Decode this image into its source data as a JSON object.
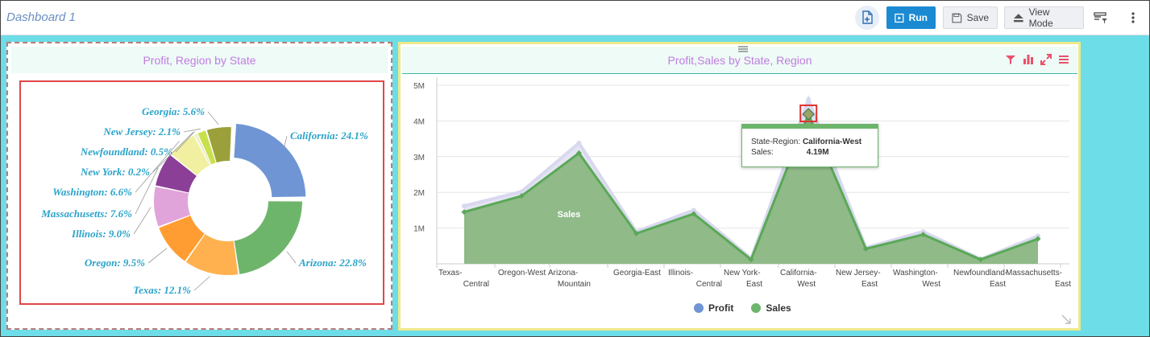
{
  "topbar": {
    "title": "Dashboard 1",
    "run_label": "Run",
    "save_label": "Save",
    "view_mode_label": "View Mode"
  },
  "panel_donut": {
    "title": "Profit, Region by State",
    "labels": [
      {
        "text": "Georgia: 5.6%"
      },
      {
        "text": "New Jersey: 2.1%"
      },
      {
        "text": "Newfoundland: 0.5%"
      },
      {
        "text": "New York: 0.2%"
      },
      {
        "text": "Washington: 6.6%"
      },
      {
        "text": "Massachusetts: 7.6%"
      },
      {
        "text": "Illinois: 9.0%"
      },
      {
        "text": "Oregon: 9.5%"
      },
      {
        "text": "Texas: 12.1%"
      },
      {
        "text": "California: 24.1%"
      },
      {
        "text": "Arizona: 22.8%"
      }
    ]
  },
  "panel_area": {
    "title": "Profit,Sales by State, Region",
    "series_label_inside": "Sales",
    "tooltip": {
      "key1": "State-Region:",
      "val1": "California-West",
      "key2": "Sales:",
      "val2": "4.19M"
    },
    "legend": [
      "Profit",
      "Sales"
    ]
  },
  "colors": {
    "accent": "#1b8ad3",
    "profit": "#6f95d4",
    "sales": "#6db56a",
    "title": "#c07de0",
    "canvas": "#6ddde7"
  },
  "chart_data": [
    {
      "type": "pie",
      "title": "Profit, Region by State",
      "donut": true,
      "categories": [
        "California",
        "Arizona",
        "Texas",
        "Oregon",
        "Illinois",
        "Massachusetts",
        "Washington",
        "New York",
        "Newfoundland",
        "New Jersey",
        "Georgia"
      ],
      "values": [
        24.1,
        22.8,
        12.1,
        9.5,
        9.0,
        7.6,
        6.6,
        0.2,
        0.5,
        2.1,
        5.6
      ],
      "colors": [
        "#6f95d4",
        "#6db56a",
        "#ffb14f",
        "#ff9d32",
        "#e0a4da",
        "#8b3f97",
        "#f0f0a0",
        "#e8e8b8",
        "#d8d870",
        "#c9e04e",
        "#9ba03a"
      ]
    },
    {
      "type": "area",
      "title": "Profit,Sales by State, Region",
      "categories": [
        "Texas-Central",
        "Oregon-West",
        "Arizona-Mountain",
        "Georgia-East",
        "Illinois-Central",
        "New York-East",
        "California-West",
        "New Jersey-East",
        "Washington-West",
        "Newfoundland-East",
        "Massachusetts-East"
      ],
      "x_tick_labels": [
        [
          "Texas-",
          "Central"
        ],
        [
          "Oregon-West"
        ],
        [
          "Arizona-",
          "Mountain"
        ],
        [
          "Georgia-East"
        ],
        [
          "Illinois-",
          "Central"
        ],
        [
          "New York-",
          "East"
        ],
        [
          "California-",
          "West"
        ],
        [
          "New Jersey-",
          "East"
        ],
        [
          "Washington-",
          "West"
        ],
        [
          "Newfoundland-",
          "East"
        ],
        [
          "Massachusetts-",
          "East"
        ]
      ],
      "series": [
        {
          "name": "Sales",
          "values": [
            1.45,
            1.9,
            3.1,
            0.85,
            1.4,
            0.12,
            4.19,
            0.42,
            0.82,
            0.12,
            0.7
          ]
        },
        {
          "name": "Profit",
          "values": [
            1.62,
            2.02,
            3.38,
            0.9,
            1.5,
            0.15,
            4.6,
            0.45,
            0.9,
            0.13,
            0.78
          ]
        }
      ],
      "y_ticks": [
        "5M",
        "4M",
        "3M",
        "2M",
        "1M"
      ],
      "ylim": [
        0,
        5
      ],
      "legend": [
        "Profit",
        "Sales"
      ],
      "legend_position": "bottom"
    }
  ]
}
